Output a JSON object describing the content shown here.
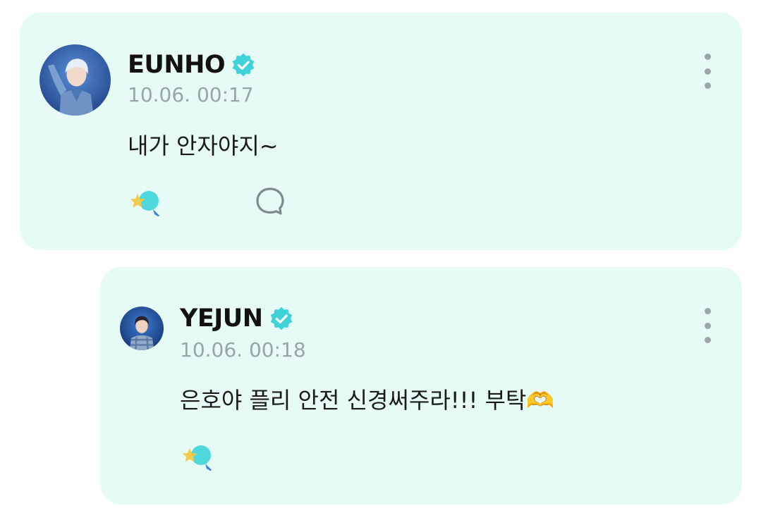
{
  "post": {
    "author": "EUNHO",
    "timestamp": "10.06. 00:17",
    "message": "내가 안자야지~"
  },
  "reply": {
    "author": "YEJUN",
    "timestamp": "10.06. 00:18",
    "message": "은호야 플리 안전 신경써주라!!! 부탁🫶"
  },
  "colors": {
    "card_background": "#e6fbf6",
    "verified_badge": "#3fd3d8",
    "timestamp": "#9aa4a7",
    "text": "#111111"
  },
  "icons": [
    "more-options-icon",
    "verified-badge-icon",
    "star-lightstick-icon",
    "comment-bubble-icon"
  ]
}
